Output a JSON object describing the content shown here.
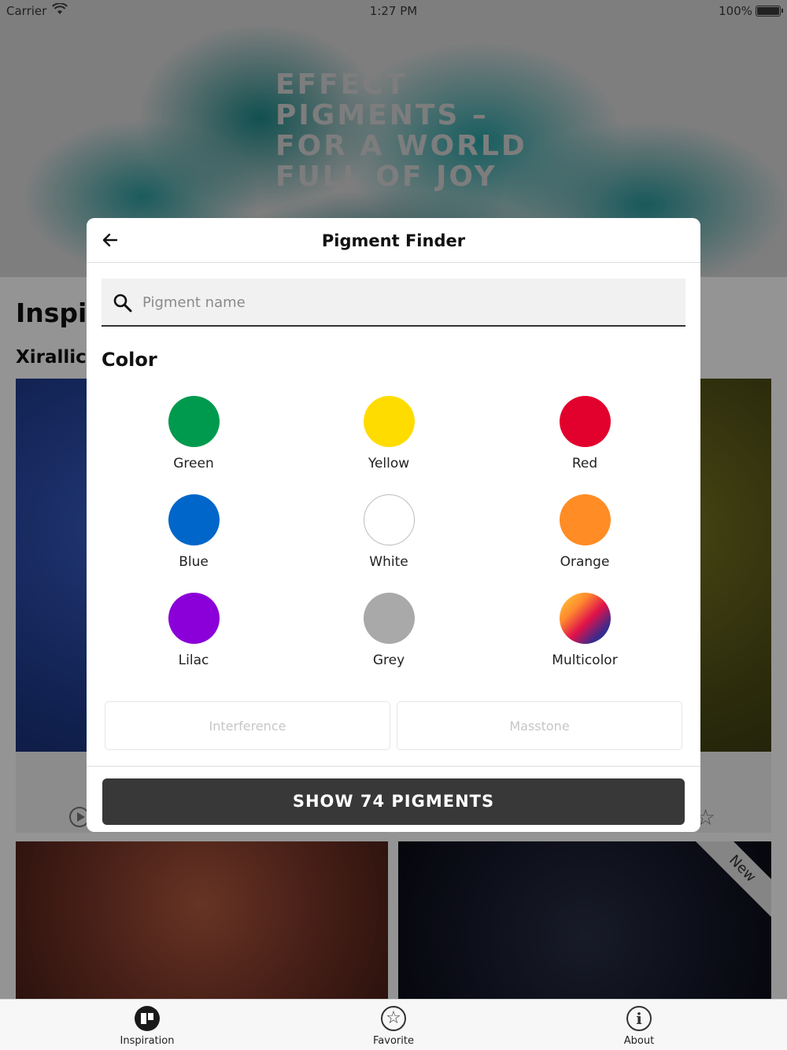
{
  "status_bar": {
    "carrier": "Carrier",
    "time": "1:27 PM",
    "battery": "100%"
  },
  "hero": {
    "title": "EFFECT PIGMENTS – FOR A WORLD FULL OF JOY"
  },
  "background": {
    "section_title": "Inspi",
    "subsection_title": "Xirallic",
    "new_badge": "New"
  },
  "modal": {
    "title": "Pigment Finder",
    "search": {
      "placeholder": "Pigment name",
      "value": ""
    },
    "color_heading": "Color",
    "colors": [
      {
        "label": "Green",
        "color": "#009a4e"
      },
      {
        "label": "Yellow",
        "color": "#ffdc00"
      },
      {
        "label": "Red",
        "color": "#e2002d"
      },
      {
        "label": "Blue",
        "color": "#0066c9"
      },
      {
        "label": "White",
        "color": "#ffffff"
      },
      {
        "label": "Orange",
        "color": "#ff8c24"
      },
      {
        "label": "Lilac",
        "color": "#8b00d8"
      },
      {
        "label": "Grey",
        "color": "#a9a9a9"
      },
      {
        "label": "Multicolor",
        "color": "gradient"
      }
    ],
    "filters": {
      "interference": "Interference",
      "masstone": "Masstone"
    },
    "show_button": "SHOW 74 PIGMENTS"
  },
  "tab_bar": {
    "inspiration": "Inspiration",
    "favorite": "Favorite",
    "about": "About"
  }
}
